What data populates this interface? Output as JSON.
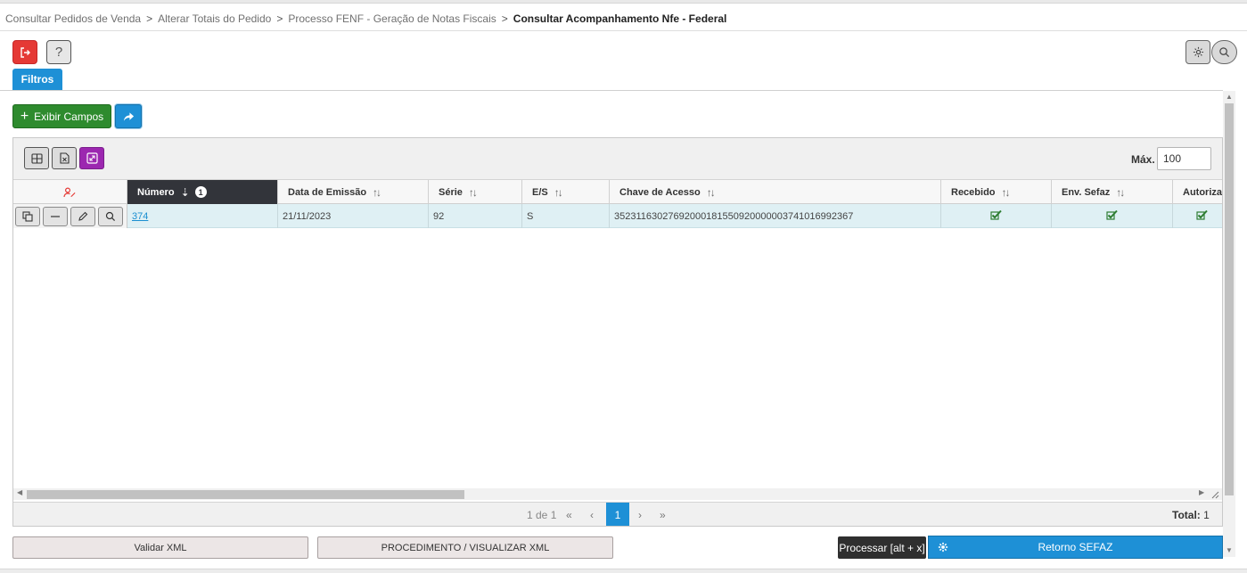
{
  "breadcrumb": {
    "items": [
      "Consultar Pedidos de Venda",
      "Alterar Totais do Pedido",
      "Processo FENF - Geração de Notas Fiscais"
    ],
    "separator": ">",
    "current": "Consultar Acompanhamento Nfe - Federal"
  },
  "top_actions": {
    "help_label": "?",
    "exit_icon": "exit-icon",
    "settings_icon": "gear-icon",
    "search_icon": "search-icon"
  },
  "tabs": {
    "filters": "Filtros"
  },
  "toolbar": {
    "show_fields_label": "Exibir Campos",
    "share_icon": "share-icon"
  },
  "grid": {
    "max_label": "Máx.",
    "max_value": "100",
    "columns": {
      "numero": "Número",
      "numero_sort_badge": "1",
      "data_emissao": "Data de Emissão",
      "serie": "Série",
      "es": "E/S",
      "chave_acesso": "Chave de Acesso",
      "recebido": "Recebido",
      "env_sefaz": "Env. Sefaz",
      "autorizado": "Autorizad"
    },
    "rows": [
      {
        "numero": "374",
        "data_emissao": "21/11/2023",
        "serie": "92",
        "es": "S",
        "chave_acesso": "35231163027692000181550920000003741016992367",
        "recebido": true,
        "env_sefaz": true,
        "autorizado": true
      }
    ]
  },
  "pagination": {
    "page_info": "1 de 1",
    "first": "«",
    "prev": "‹",
    "current_page": "1",
    "next": "›",
    "last": "»",
    "total_label": "Total:",
    "total_value": "1"
  },
  "footer": {
    "validar_xml": "Validar XML",
    "procedimento": "PROCEDIMENTO / VISUALIZAR XML",
    "tooltip": "Processar [alt + x]",
    "retorno_sefaz": "Retorno SEFAZ"
  },
  "colors": {
    "primary": "#1e90d6",
    "danger": "#e53935",
    "success": "#2e8b2e",
    "purple": "#9c27b0",
    "header_active": "#32343a",
    "row_selected": "#dff0f4",
    "check_green": "#2e7d32"
  }
}
